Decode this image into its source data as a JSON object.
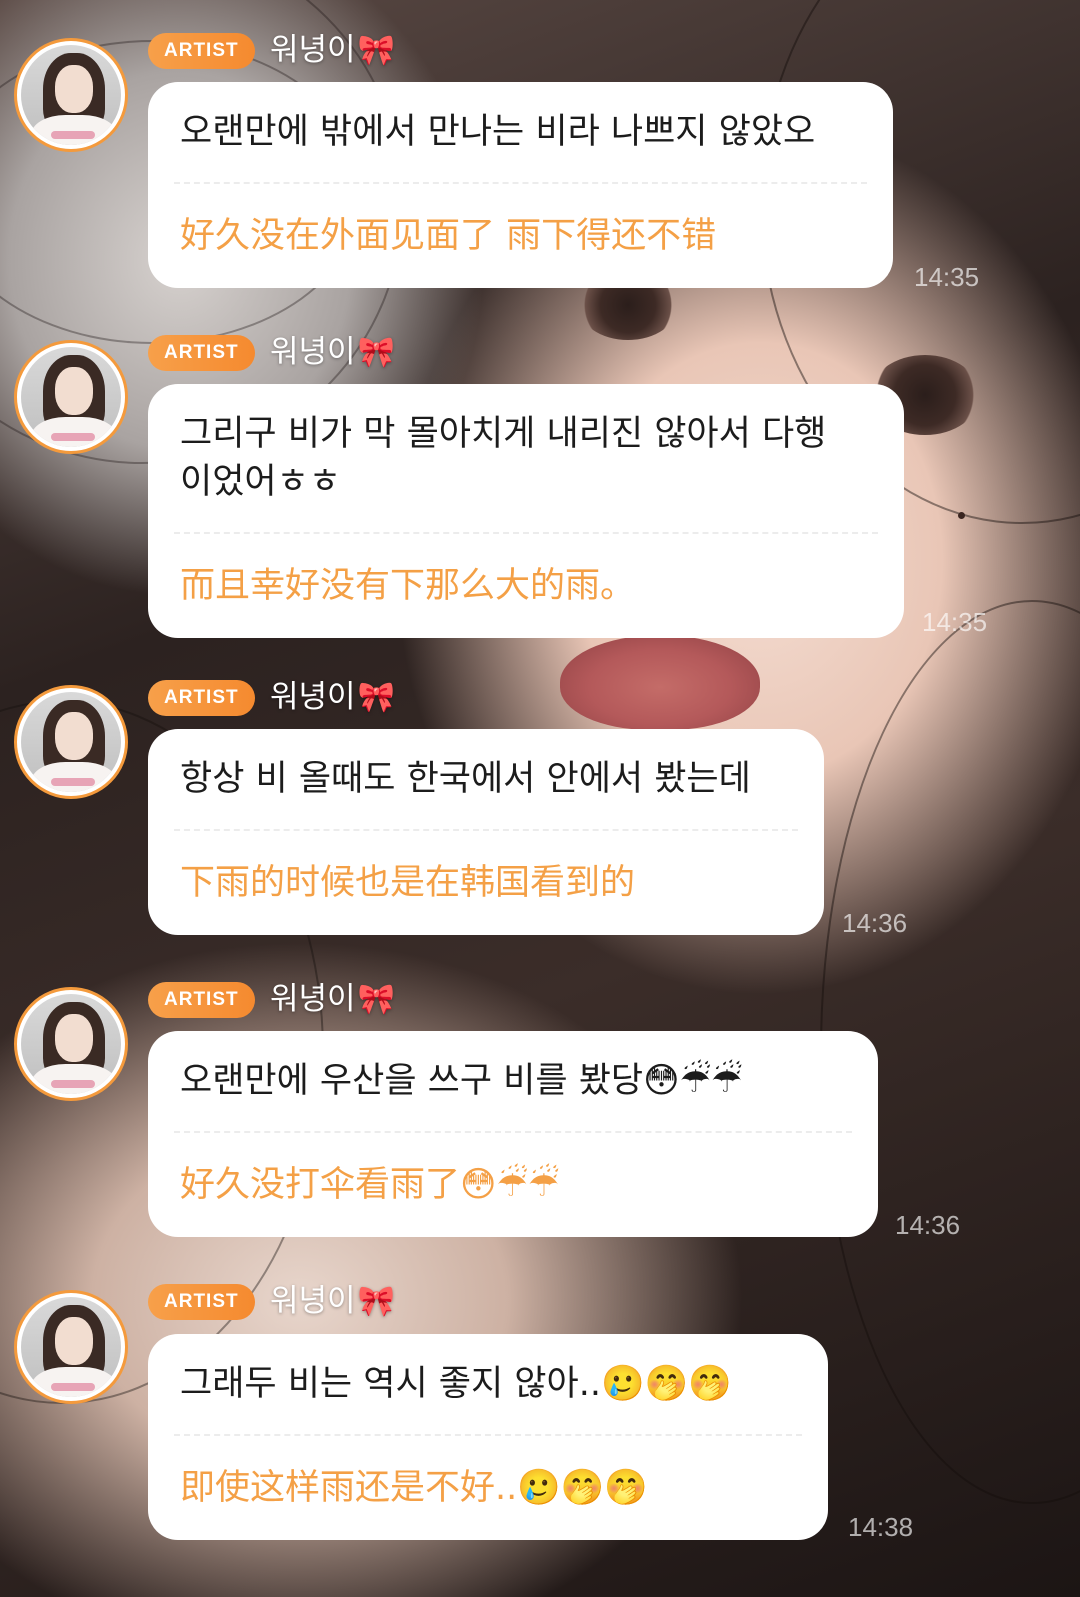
{
  "chat": {
    "messages": [
      {
        "badge": "ARTIST",
        "sender": "워녕이",
        "ribbon": "🎀",
        "korean": "오랜만에 밖에서 만나는 비라 나쁘지 않았오",
        "chinese": "好久没在外面见面了 雨下得还不错",
        "time": "14:35"
      },
      {
        "badge": "ARTIST",
        "sender": "워녕이",
        "ribbon": "🎀",
        "korean": "그리구 비가 막 몰아치게 내리진 않아서 다행\n이었어ㅎㅎ",
        "chinese": "而且幸好没有下那么大的雨。",
        "time": "14:35"
      },
      {
        "badge": "ARTIST",
        "sender": "워녕이",
        "ribbon": "🎀",
        "korean": "항상 비 올때도 한국에서 안에서 봤는데",
        "chinese": "下雨的时候也是在韩国看到的",
        "time": "14:36"
      },
      {
        "badge": "ARTIST",
        "sender": "워녕이",
        "ribbon": "🎀",
        "korean": "오랜만에 우산을 쓰구 비를 봤당😳☔☔",
        "chinese": "好久没打伞看雨了😳☔☔",
        "time": "14:36"
      },
      {
        "badge": "ARTIST",
        "sender": "워녕이",
        "ribbon": "🎀",
        "korean": "그래두 비는 역시 좋지 않아..🥲🤭🤭",
        "chinese": "即使这样雨还是不好..🥲🤭🤭",
        "time": "14:38"
      }
    ]
  }
}
